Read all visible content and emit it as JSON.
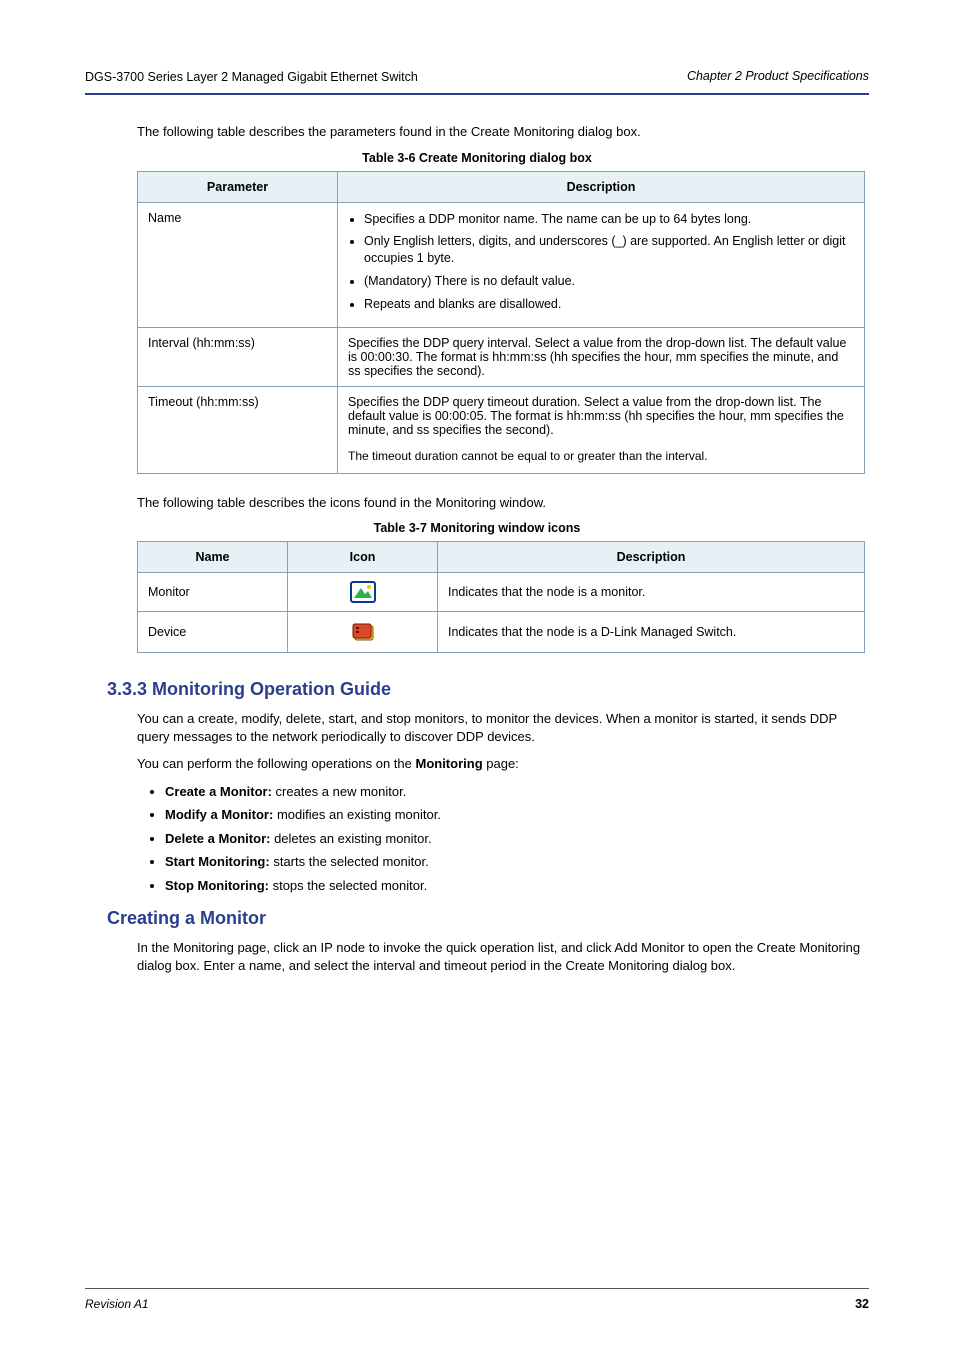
{
  "header": {
    "left": "DGS-3700 Series Layer 2 Managed Gigabit Ethernet Switch",
    "right": "Chapter 2 Product Specifications"
  },
  "monitoring_intro": "The following table describes the parameters found in the Create Monitoring dialog box.",
  "monitoring_caption": "Table 3-6 Create Monitoring dialog box",
  "monitoring_table": {
    "headers": [
      "Parameter",
      "Description"
    ],
    "rows": [
      {
        "param": "Name",
        "desc_items": [
          "Specifies a DDP monitor name. The name can be up to 64 bytes long.",
          "Only English letters, digits, and underscores (_) are supported. An English letter or digit occupies 1 byte.",
          "(Mandatory) There is no default value.",
          "Repeats and blanks are disallowed."
        ]
      },
      {
        "param": "Interval (hh:mm:ss)",
        "desc_plain": "Specifies the DDP query interval. Select a value from the drop-down list. The default value is 00:00:30. The format is hh:mm:ss (hh specifies the hour, mm specifies the minute, and ss specifies the second)."
      },
      {
        "param": "Timeout (hh:mm:ss)",
        "desc_items": [
          "Specifies the DDP query timeout duration. Select a value from the drop-down list. The default value is 00:00:05. The format is hh:mm:ss (hh specifies the hour, mm specifies the minute, and ss specifies the second).",
          "The timeout duration cannot be equal to or greater than the interval."
        ],
        "note_style": true
      }
    ]
  },
  "icons_intro": "The following table describes the icons found in the Monitoring window.",
  "icons_caption": "Table 3-7 Monitoring window icons",
  "icons_table": {
    "headers": [
      "Name",
      "Icon",
      "Description"
    ],
    "rows": [
      {
        "name": "Monitor",
        "icon": "monitor",
        "desc": "Indicates that the node is a monitor."
      },
      {
        "name": "Device",
        "icon": "device",
        "desc": "Indicates that the node is a D-Link Managed Switch."
      }
    ]
  },
  "guide_heading": "3.3.3 Monitoring Operation Guide",
  "guide_para1": "You can a create, modify, delete, start, and stop monitors, to monitor the devices. When a monitor is started, it sends DDP query messages to the network periodically to discover DDP devices.",
  "guide_para2_prefix": "You can perform the following operations on the ",
  "guide_para2_bold": "Monitoring",
  "guide_para2_suffix": " page:",
  "guide_ops": [
    {
      "bold": "Create a Monitor:",
      "text": " creates a new monitor."
    },
    {
      "bold": "Modify a Monitor:",
      "text": " modifies an existing monitor."
    },
    {
      "bold": "Delete a Monitor:",
      "text": " deletes an existing monitor."
    },
    {
      "bold": "Start Monitoring:",
      "text": " starts the selected monitor."
    },
    {
      "bold": "Stop Monitoring:",
      "text": " stops the selected monitor."
    }
  ],
  "create_heading": "Creating a Monitor",
  "create_para": "In the Monitoring page, click an IP node to invoke the quick operation list, and click Add Monitor to open the Create Monitoring dialog box. Enter a name, and select the interval and timeout period in the Create Monitoring dialog box.",
  "footer": {
    "revision": "Revision A1",
    "page": "32"
  }
}
